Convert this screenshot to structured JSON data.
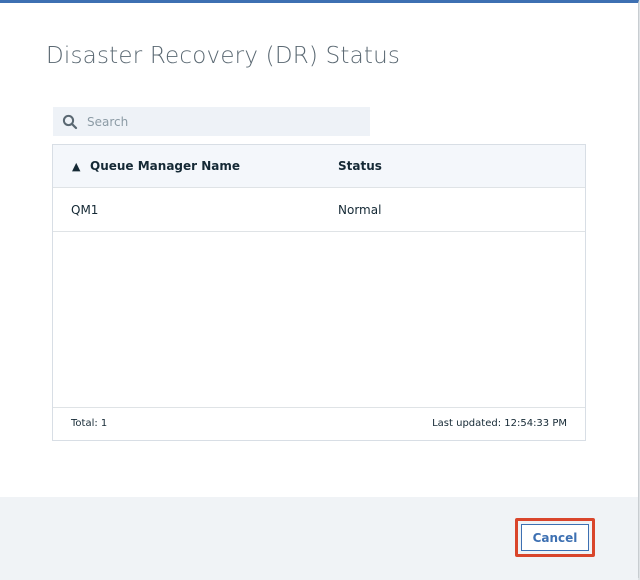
{
  "dialog": {
    "title": "Disaster Recovery (DR) Status"
  },
  "search": {
    "placeholder": "Search",
    "icon": "search-icon"
  },
  "table": {
    "sort_indicator": "▲",
    "columns": [
      "Queue Manager Name",
      "Status"
    ],
    "rows": [
      {
        "queue_manager_name": "QM1",
        "status": "Normal"
      }
    ],
    "footer": {
      "total": "Total: 1",
      "last_updated": "Last updated: 12:54:33 PM"
    }
  },
  "actions": {
    "cancel_label": "Cancel"
  },
  "colors": {
    "accent": "#3d70b2",
    "highlight": "#d9452b",
    "title_text": "#5a6872",
    "header_bg": "#f4f7fb",
    "footer_bg": "#f0f3f6"
  }
}
